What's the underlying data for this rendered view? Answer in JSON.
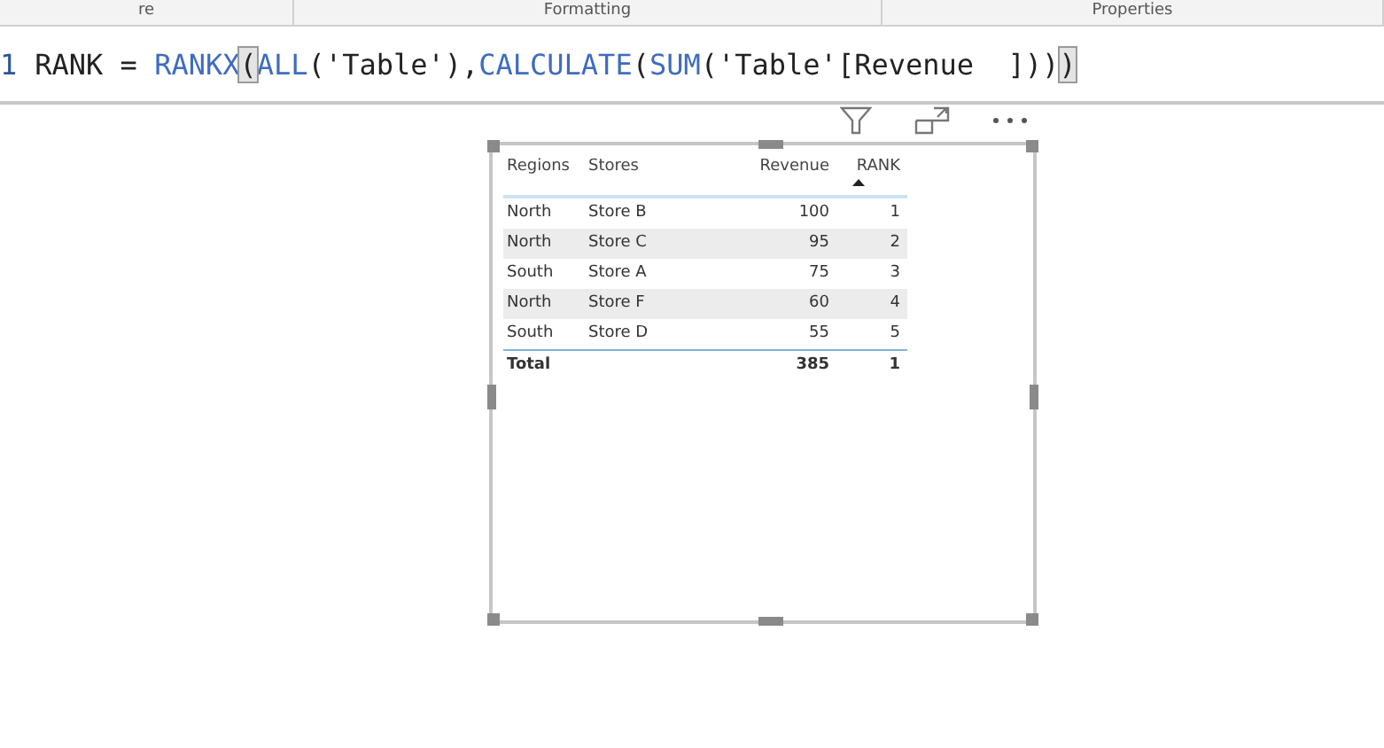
{
  "pane_tabs": [
    {
      "label": "re"
    },
    {
      "label": "Formatting"
    },
    {
      "label": "Properties"
    }
  ],
  "formula_bar": {
    "line_number": "1",
    "tokens": [
      {
        "kind": "plain",
        "text": "RANK = "
      },
      {
        "kind": "function",
        "text": "RANKX"
      },
      {
        "kind": "match",
        "text": "("
      },
      {
        "kind": "function",
        "text": "ALL"
      },
      {
        "kind": "plain",
        "text": "('Table'),"
      },
      {
        "kind": "function",
        "text": "CALCULATE"
      },
      {
        "kind": "plain",
        "text": "("
      },
      {
        "kind": "function",
        "text": "SUM"
      },
      {
        "kind": "plain",
        "text": "('Table'[Revenue  ]))"
      },
      {
        "kind": "match",
        "text": ")"
      }
    ]
  },
  "table": {
    "columns": [
      {
        "label": "Regions",
        "kind": "text",
        "sorted": false
      },
      {
        "label": "Stores",
        "kind": "text",
        "sorted": false
      },
      {
        "label": "Revenue",
        "kind": "number",
        "sorted": false
      },
      {
        "label": "RANK",
        "kind": "number",
        "sorted": true
      }
    ],
    "rows": [
      [
        "North",
        "Store B",
        "100",
        "1"
      ],
      [
        "North",
        "Store C",
        "95",
        "2"
      ],
      [
        "South",
        "Store A",
        "75",
        "3"
      ],
      [
        "North",
        "Store F",
        "60",
        "4"
      ],
      [
        "South",
        "Store D",
        "55",
        "5"
      ]
    ],
    "total": {
      "label": "Total",
      "revenue": "385",
      "rank": "1"
    }
  }
}
